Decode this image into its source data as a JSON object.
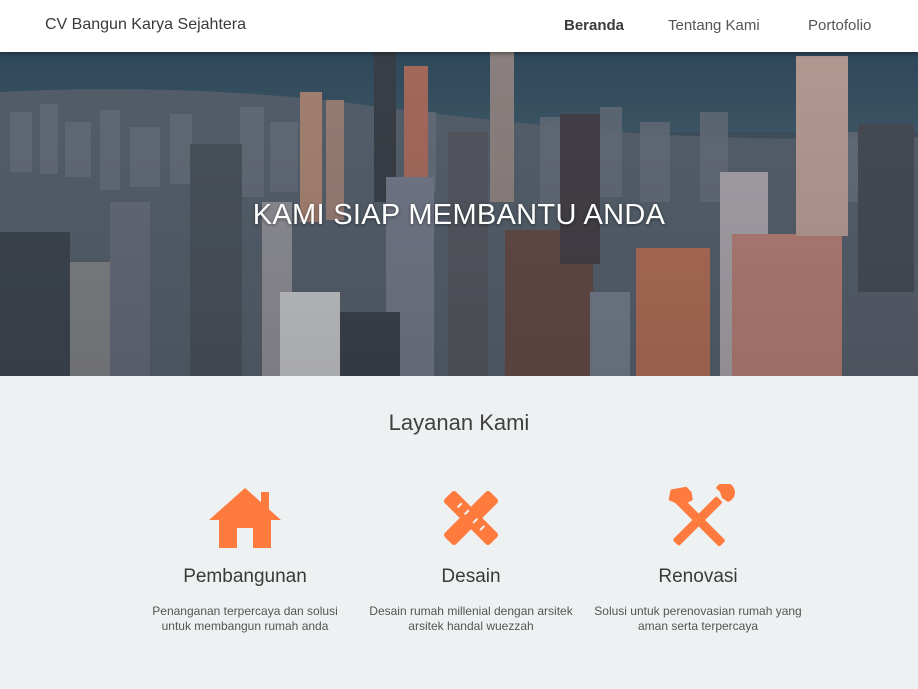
{
  "navbar": {
    "brand": "CV Bangun Karya Sejahtera",
    "items": [
      {
        "label": "Beranda",
        "active": true
      },
      {
        "label": "Tentang Kami",
        "active": false
      },
      {
        "label": "Portofolio",
        "active": false
      }
    ]
  },
  "hero": {
    "title": "KAMI SIAP MEMBANTU ANDA",
    "image": "city-skyline-aerial"
  },
  "services": {
    "title": "Layanan Kami",
    "accent_color": "#ff7a3d",
    "items": [
      {
        "icon": "house-icon",
        "title": "Pembangunan",
        "description": "Penanganan terpercaya dan solusi untuk membangun rumah anda"
      },
      {
        "icon": "pencil-ruler-icon",
        "title": "Desain",
        "description": "Desain rumah millenial dengan arsitek arsitek handal wuezzah"
      },
      {
        "icon": "hammer-wrench-icon",
        "title": "Renovasi",
        "description": "Solusi untuk perenovasian rumah yang aman serta terpercaya"
      }
    ]
  }
}
